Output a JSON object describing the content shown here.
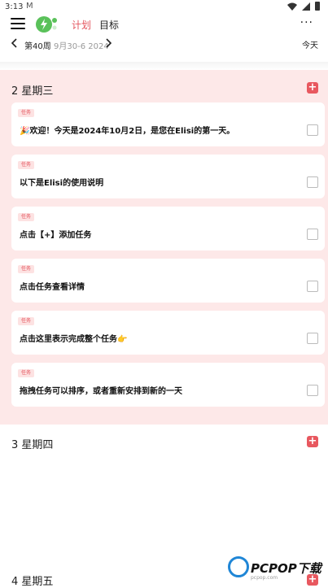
{
  "status_bar": {
    "time": "3:13",
    "mail_icon": "M"
  },
  "header": {
    "tabs": [
      {
        "label": "计划"
      },
      {
        "label": "目标"
      }
    ],
    "more_label": "···"
  },
  "week": {
    "label": "第40周",
    "range": "9月30-6 2024",
    "today_label": "今天"
  },
  "days": [
    {
      "title": "2 星期三",
      "tasks": [
        {
          "badge": "任务",
          "text": "🎉欢迎！今天是2024年10月2日，是您在Elisi的第一天。"
        },
        {
          "badge": "任务",
          "text": "以下是Elisi的使用说明"
        },
        {
          "badge": "任务",
          "text": "点击【+】添加任务"
        },
        {
          "badge": "任务",
          "text": "点击任务查看详情"
        },
        {
          "badge": "任务",
          "text": "点击这里表示完成整个任务👉"
        },
        {
          "badge": "任务",
          "text": "拖拽任务可以排序，或者重新安排到新的一天"
        }
      ]
    },
    {
      "title": "3 星期四"
    },
    {
      "title": "4 星期五"
    }
  ],
  "watermark": {
    "text": "PCPOP下载",
    "sub": "pcpop.com"
  },
  "colors": {
    "accent": "#e4565f",
    "section_bg": "#fde8e8",
    "add_button": "#e8585f"
  }
}
